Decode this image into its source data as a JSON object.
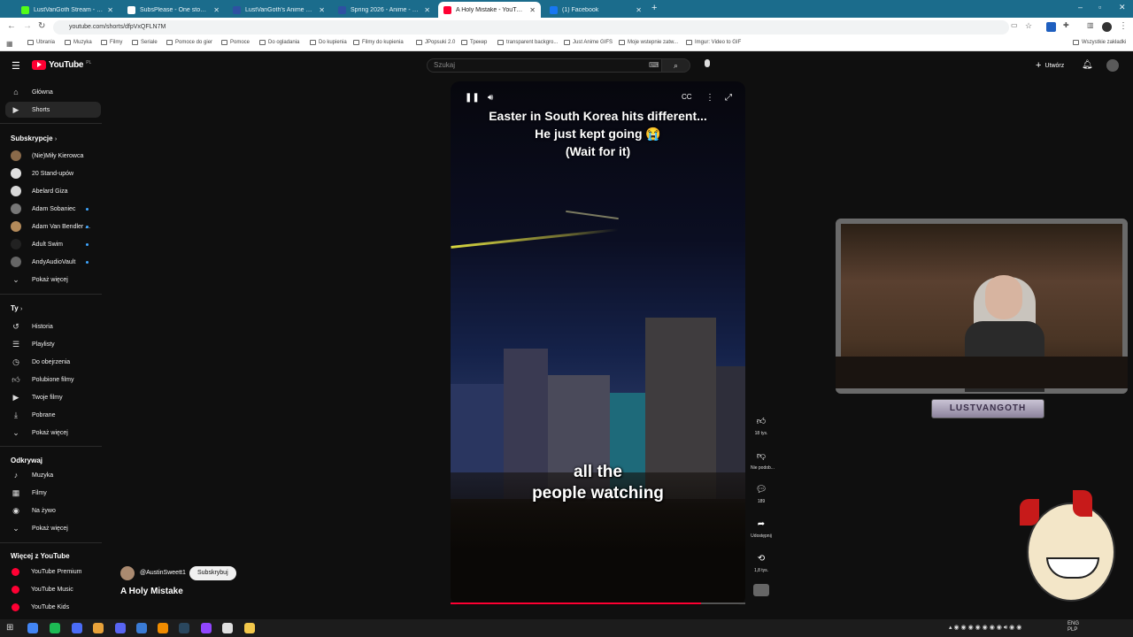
{
  "browser": {
    "tabs": [
      {
        "title": "LustVanGoth Stream - Watch Li...",
        "color": "#53fc18",
        "active": false
      },
      {
        "title": "SubsPlease - One stop shop fo...",
        "color": "#ffffff",
        "active": false
      },
      {
        "title": "LustVanGoth's Anime List - My...",
        "color": "#2e51a2",
        "active": false
      },
      {
        "title": "Spring 2026 - Anime - MyAnim...",
        "color": "#2e51a2",
        "active": false
      },
      {
        "title": "A Holy Mistake - YouTube",
        "color": "#ff0033",
        "active": true
      },
      {
        "title": "(1) Facebook",
        "color": "#1877f2",
        "active": false
      }
    ],
    "new_tab_icon": "plus-icon",
    "url": "youtube.com/shorts/dfpVxQFLN7M",
    "bookmarks": [
      "Ubrania",
      "Muzyka",
      "Filmy",
      "Seriale",
      "Pomoce do gier",
      "Pomoce",
      "Do ogladania",
      "Do kupienia",
      "Filmy do kupienia",
      "JPopsuki 2.0",
      "Трекер",
      "transparent backgro...",
      "Just Anime GIFS",
      "Moje wstepnie zatw...",
      "Imgur: Video to GIF"
    ],
    "all_bookmarks": "Wszystkie zakładki"
  },
  "youtube": {
    "logo": "YouTube",
    "region": "PL",
    "search_placeholder": "Szukaj",
    "create_label": "Utwórz",
    "nav": [
      {
        "label": "Główna",
        "icon": "home-icon"
      },
      {
        "label": "Shorts",
        "icon": "shorts-icon"
      }
    ],
    "subscriptions_header": "Subskrypcje",
    "subscriptions": [
      {
        "label": "(Nie)Miły Kierowca",
        "color": "#8a6a4a",
        "dot": false
      },
      {
        "label": "20 Stand-upów",
        "color": "#e0e0e0",
        "dot": false
      },
      {
        "label": "Abelard Giza",
        "color": "#d9d9d9",
        "dot": false
      },
      {
        "label": "Adam Sobaniec",
        "color": "#777777",
        "dot": true
      },
      {
        "label": "Adam Van Bendler ...",
        "color": "#b38a5a",
        "dot": true
      },
      {
        "label": "Adult Swim",
        "color": "#222222",
        "dot": true
      },
      {
        "label": "AndyAudioVault",
        "color": "#666666",
        "dot": true
      }
    ],
    "show_more": "Pokaż więcej",
    "you_header": "Ty",
    "you_items": [
      {
        "label": "Historia",
        "icon": "history-icon"
      },
      {
        "label": "Playlisty",
        "icon": "playlist-icon"
      },
      {
        "label": "Do obejrzenia",
        "icon": "watch-later-icon"
      },
      {
        "label": "Polubione filmy",
        "icon": "like-icon"
      },
      {
        "label": "Twoje filmy",
        "icon": "video-icon"
      },
      {
        "label": "Pobrane",
        "icon": "download-icon"
      },
      {
        "label": "Pokaż więcej",
        "icon": "chevron-down-icon"
      }
    ],
    "explore_header": "Odkrywaj",
    "explore_items": [
      {
        "label": "Muzyka",
        "icon": "music-icon"
      },
      {
        "label": "Filmy",
        "icon": "film-icon"
      },
      {
        "label": "Na żywo",
        "icon": "live-icon"
      },
      {
        "label": "Pokaż więcej",
        "icon": "chevron-down-icon"
      }
    ],
    "more_header": "Więcej z YouTube",
    "more_items": [
      {
        "label": "YouTube Premium"
      },
      {
        "label": "YouTube Music"
      },
      {
        "label": "YouTube Kids"
      }
    ]
  },
  "short": {
    "overlay_title_line1": "Easter in South Korea hits different...",
    "overlay_title_line2": "He just kept going 😭",
    "overlay_title_line3": "(Wait for it)",
    "caption_line1": "all the",
    "caption_line2": "people watching",
    "channel": "@AustinSweett1",
    "subscribe_label": "Subskrybuj",
    "title": "A Holy Mistake",
    "progress": 0.85,
    "actions": {
      "likes": "18 tys.",
      "dislike": "Nie podob...",
      "comments": "189",
      "share": "Udostępnij",
      "remix": "1,8 tys."
    }
  },
  "stream": {
    "logo_text": "LUSTVANGOTH"
  },
  "taskbar": {
    "lang1": "ENG",
    "lang2": "PLP"
  }
}
